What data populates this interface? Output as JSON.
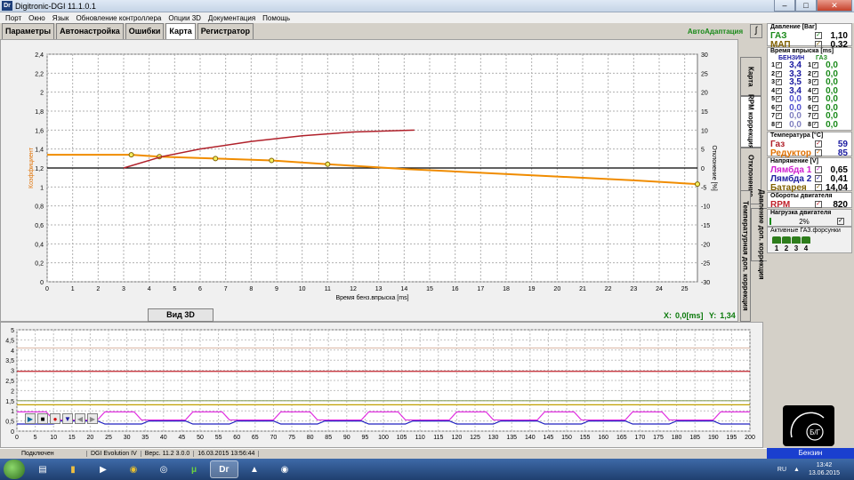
{
  "window": {
    "title": "Digitronic-DGI  11.1.0.1",
    "app_icon": "Dr"
  },
  "menu": [
    "Порт",
    "Окно",
    "Язык",
    "Обновление контроллера",
    "Опции 3D",
    "Документация",
    "Помощь"
  ],
  "tabs": [
    "Параметры",
    "Автонастройка",
    "Ошибки",
    "Карта",
    "Регистратор"
  ],
  "autoadapt_label": "АвтоАдаптация",
  "vertical_tabs": [
    "Карта",
    "RPM коррекция",
    "Отклонение",
    "Давление доп. коррекция",
    "Температурная доп. коррекция"
  ],
  "view3d_label": "Вид 3D",
  "xy_readout": {
    "x_label": "X:",
    "x_value": "0,0[ms]",
    "y_label": "Y:",
    "y_value": "1,34"
  },
  "main_chart": {
    "ylabel_left": "Коэффициент",
    "ylabel_right": "Отклонение [%]",
    "xlabel": "Время бенз.впрыска [ms]",
    "left_ticks": [
      "0",
      "0,2",
      "0,4",
      "0,6",
      "0,8",
      "1",
      "1,2",
      "1,4",
      "1,6",
      "1,8",
      "2",
      "2,2",
      "2,4"
    ],
    "right_ticks": [
      "-30",
      "-25",
      "-20",
      "-15",
      "-10",
      "-5",
      "0",
      "5",
      "10",
      "15",
      "20",
      "25",
      "30"
    ],
    "x_ticks": [
      "0",
      "1",
      "2",
      "3",
      "4",
      "5",
      "6",
      "7",
      "8",
      "9",
      "10",
      "11",
      "12",
      "13",
      "14",
      "15",
      "16",
      "17",
      "18",
      "19",
      "20",
      "21",
      "22",
      "23",
      "24",
      "25"
    ]
  },
  "chart_data": {
    "type": "line",
    "x": [
      0,
      3.3,
      4.4,
      6.6,
      8.8,
      11,
      14,
      17,
      20,
      23,
      25.5
    ],
    "xlabel": "Время бенз.впрыска [ms]",
    "ylabel": "Коэффициент",
    "ylim": [
      0,
      2.4
    ],
    "xlim": [
      0,
      25.5
    ],
    "y2label": "Отклонение [%]",
    "y2lim": [
      -30,
      30
    ],
    "series": [
      {
        "values": [
          1.34,
          1.34,
          1.32,
          1.3,
          1.28,
          1.24,
          1.19,
          1.15,
          1.11,
          1.07,
          1.03
        ],
        "color": "#f08c00"
      },
      {
        "x": [
          3.0,
          4.5,
          6.0,
          8.0,
          10.0,
          12.0,
          14.4
        ],
        "values": [
          0,
          3,
          5,
          7,
          8.5,
          9.5,
          10
        ],
        "axis": "right",
        "color": "#b0202a"
      }
    ],
    "grid": true
  },
  "lower_chart": {
    "y_ticks": [
      "0",
      "0,5",
      "1",
      "1,5",
      "2",
      "2,5",
      "3",
      "3,5",
      "4",
      "4,5",
      "5"
    ],
    "x_ticks": [
      "0",
      "5",
      "10",
      "15",
      "20",
      "25",
      "30",
      "35",
      "40",
      "45",
      "50",
      "55",
      "60",
      "65",
      "70",
      "75",
      "80",
      "85",
      "90",
      "95",
      "100",
      "105",
      "110",
      "115",
      "120",
      "125",
      "130",
      "135",
      "140",
      "145",
      "150",
      "155",
      "160",
      "165",
      "170",
      "175",
      "180",
      "185",
      "190",
      "195",
      "200"
    ],
    "levels": [
      {
        "value": 4.1,
        "color": "#e0c0b0"
      },
      {
        "value": 2.95,
        "color": "#c0202a"
      },
      {
        "value": 1.5,
        "color": "#8aa060"
      },
      {
        "value": 1.3,
        "color": "#c0a000"
      },
      {
        "value": 0.65,
        "color": "#e030e0"
      },
      {
        "value": 0.4,
        "color": "#2020c0"
      }
    ]
  },
  "pressure": {
    "header": "Давление [Bar]",
    "rows": [
      {
        "name": "ГАЗ",
        "value": "1,10",
        "color": "#1a8a1a"
      },
      {
        "name": "МАП",
        "value": "0,32",
        "color": "#806000"
      }
    ]
  },
  "injection": {
    "header": "Время впрыска [ms]",
    "petrol_label": "БЕНЗИН",
    "gas_label": "ГАЗ",
    "rows": [
      {
        "n": "1",
        "petrol": "3,4",
        "gas": "0,0"
      },
      {
        "n": "2",
        "petrol": "3,3",
        "gas": "0,0"
      },
      {
        "n": "3",
        "petrol": "3,5",
        "gas": "0,0"
      },
      {
        "n": "4",
        "petrol": "3,4",
        "gas": "0,0"
      },
      {
        "n": "5",
        "petrol": "0,0",
        "gas": "0,0"
      },
      {
        "n": "6",
        "petrol": "0,0",
        "gas": "0,0"
      },
      {
        "n": "7",
        "petrol": "0,0",
        "gas": "0,0"
      },
      {
        "n": "8",
        "petrol": "0,0",
        "gas": "0,0"
      }
    ]
  },
  "temperature": {
    "header": "Температура [°C]",
    "rows": [
      {
        "name": "Газ",
        "value": "59",
        "color": "#b0202a"
      },
      {
        "name": "Редуктор",
        "value": "85",
        "color": "#e07000"
      }
    ]
  },
  "voltage": {
    "header": "Напряжение [V]",
    "rows": [
      {
        "name": "Лямбда 1",
        "value": "0,65",
        "color": "#d020d0"
      },
      {
        "name": "Лямбда 2",
        "value": "0,41",
        "color": "#2020a0"
      },
      {
        "name": "Батарея",
        "value": "14,04",
        "color": "#806000"
      }
    ]
  },
  "rpm": {
    "header": "Обороты двигателя",
    "name": "RPM",
    "value": "820",
    "color": "#c0202a"
  },
  "load": {
    "header": "Нагрузка двигателя",
    "value": "2%",
    "progress": 0.02
  },
  "active_injectors": {
    "header": "Активные ГАЗ.форсунки",
    "labels": [
      "1",
      "2",
      "3",
      "4"
    ]
  },
  "logo_text": "Б/Г",
  "fuel_status": "Бензин",
  "statusbar": {
    "connection": "Подключен",
    "device": "DGI Evolution IV",
    "version": "Верс. 11.2  3.0.0",
    "datetime": "16.03.2015 13:56:44"
  },
  "tray": {
    "lang": "RU",
    "time": "13:42",
    "date": "13.06.2015"
  },
  "taskbar_active": "Dг"
}
